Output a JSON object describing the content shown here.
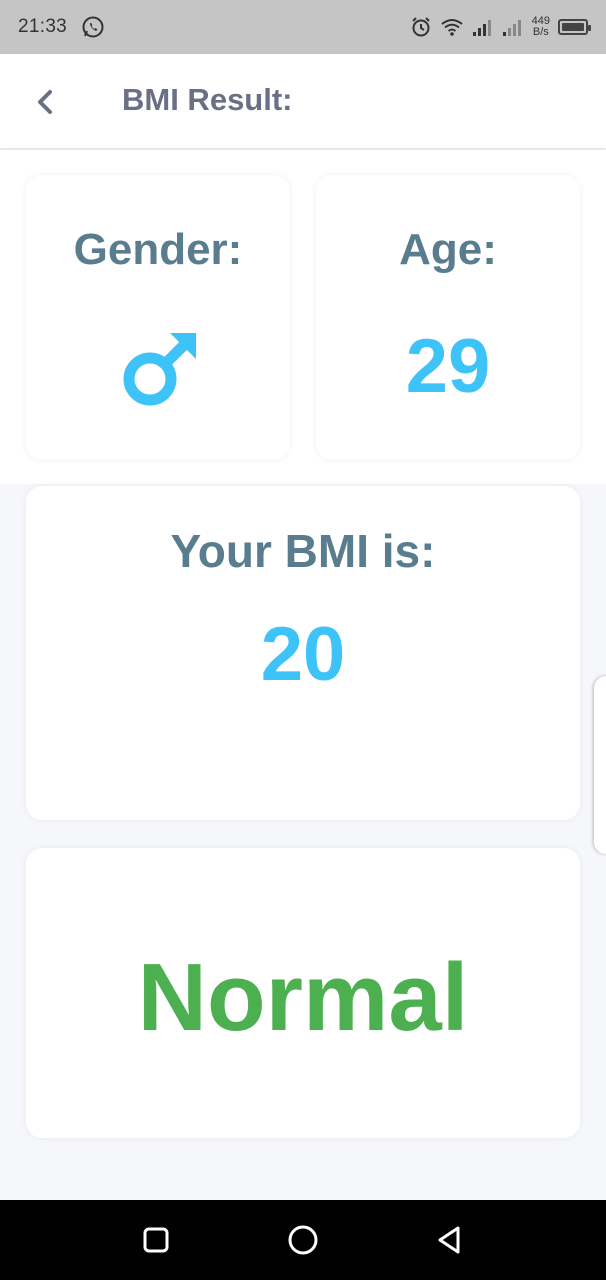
{
  "status_bar": {
    "time": "21:33",
    "net_speed_value": "449",
    "net_speed_unit": "B/s",
    "icons": [
      "whatsapp-icon",
      "alarm-icon",
      "wifi-icon",
      "signal-icon",
      "signal-icon",
      "battery-icon"
    ]
  },
  "app_bar": {
    "title": "BMI Result:",
    "back_icon": "chevron-left-icon"
  },
  "gender_card": {
    "label": "Gender:",
    "icon": "male-icon"
  },
  "age_card": {
    "label": "Age:",
    "value": "29"
  },
  "bmi_card": {
    "label": "Your BMI is:",
    "value": "20"
  },
  "status_card": {
    "status": "Normal"
  },
  "nav_bar": {
    "buttons": [
      "recents-square-icon",
      "home-circle-icon",
      "back-triangle-icon"
    ]
  },
  "colors": {
    "label": "#5a7c8f",
    "value": "#3dc3f8",
    "status": "#4caf50",
    "title": "#6b6f86"
  }
}
